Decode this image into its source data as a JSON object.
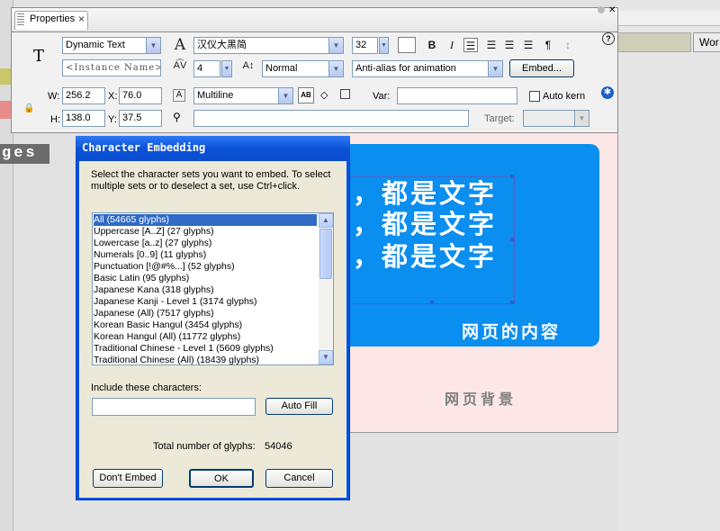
{
  "panel": {
    "tab_label": "Properties",
    "tab_close": "×",
    "help_icon": "?",
    "text_type": "Dynamic Text",
    "instance_name_placeholder": "<Instance Name>",
    "font_family": "汉仪大黑简",
    "font_size": "32",
    "letter_spacing": "4",
    "char_position": "Normal",
    "anti_alias": "Anti-alias for animation",
    "embed_button": "Embed...",
    "line_type": "Multiline",
    "var_label": "Var:",
    "var_value": "",
    "auto_kern_label": "Auto kern",
    "auto_kern_checked": false,
    "url_value": "",
    "target_label": "Target:",
    "target_value": "",
    "w_label": "W:",
    "w_value": "256.2",
    "x_label": "X:",
    "x_value": "76.0",
    "h_label": "H:",
    "h_value": "138.0",
    "y_label": "Y:",
    "y_value": "37.5",
    "text_tool_glyph": "T",
    "font_icon_glyph": "A",
    "bold_glyph": "B",
    "italic_glyph": "I",
    "paragraph_glyph": "¶",
    "selectable_glyph": "AB",
    "icons": [
      "text-tool-icon",
      "font-family-icon",
      "letter-spacing-icon",
      "font-size-icon",
      "lock-icon",
      "format-icon",
      "link-icon",
      "bold-icon",
      "italic-icon",
      "align-left-icon",
      "align-center-icon",
      "align-right-icon",
      "justify-icon",
      "paragraph-icon",
      "accessibility-icon"
    ]
  },
  "stage": {
    "left_label": "ges",
    "wor_button": "Wor",
    "text_lines": [
      "，都是文字",
      "，都是文字",
      "，都是文字"
    ],
    "content_label": "网页的内容",
    "background_label": "网页背景",
    "colors": {
      "blue_box": "#0a8ef0",
      "pink_bg": "#fde6e6"
    }
  },
  "dialog": {
    "title": "Character Embedding",
    "instructions": [
      "Select the character sets you want to embed. To select",
      "multiple sets or to deselect a set, use Ctrl+click."
    ],
    "list_items": [
      "All  (54665 glyphs)",
      "Uppercase [A..Z]  (27 glyphs)",
      "Lowercase [a..z]  (27 glyphs)",
      "Numerals [0..9]  (11 glyphs)",
      "Punctuation [!@#%...]  (52 glyphs)",
      "Basic Latin  (95 glyphs)",
      "Japanese Kana  (318 glyphs)",
      "Japanese Kanji - Level 1 (3174 glyphs)",
      "Japanese (All)  (7517 glyphs)",
      "Korean Basic Hangul (3454 glyphs)",
      "Korean Hangul (All) (11772 glyphs)",
      "Traditional Chinese - Level 1 (5609 glyphs)",
      "Traditional Chinese (All)  (18439 glyphs)"
    ],
    "selected_index": 0,
    "include_label": "Include these characters:",
    "include_value": "",
    "auto_fill_button": "Auto Fill",
    "total_label": "Total number of glyphs:",
    "total_value": "54046",
    "dont_embed_button": "Don't Embed",
    "ok_button": "OK",
    "cancel_button": "Cancel"
  }
}
